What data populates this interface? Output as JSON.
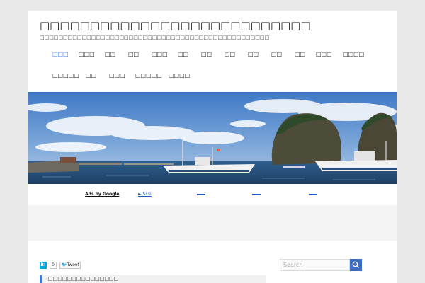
{
  "header": {
    "site_title": "□□□□□□□□□□□□□□□□□□□□□□□□□□□",
    "site_description": "□□□□□□□□□□□□□□□□□□□□□□□□□□□□□□□□□□□□□□□□□□□□□□□□□"
  },
  "nav": {
    "row1": [
      "□□□",
      "□□□",
      "□□",
      "□□",
      "□□□",
      "□□",
      "□□",
      "□□",
      "□□",
      "□□",
      "□□",
      "□□□",
      "□□□□"
    ],
    "row2": [
      "□□□□□",
      "□□",
      "□□□",
      "□□□□□",
      "□□□□"
    ],
    "active_index": 0
  },
  "ads": {
    "label": "Ads by Google",
    "link1": "► Si si"
  },
  "share": {
    "hatena_label": "B!",
    "count": "0",
    "tweet_label": "Tweet"
  },
  "post": {
    "title": "□□□□□□□□□□□□□□□"
  },
  "search": {
    "placeholder": "Search"
  },
  "colors": {
    "accent": "#3a7bd5",
    "page_background": "#e9e9e9",
    "search_button": "#3a6fc4"
  }
}
